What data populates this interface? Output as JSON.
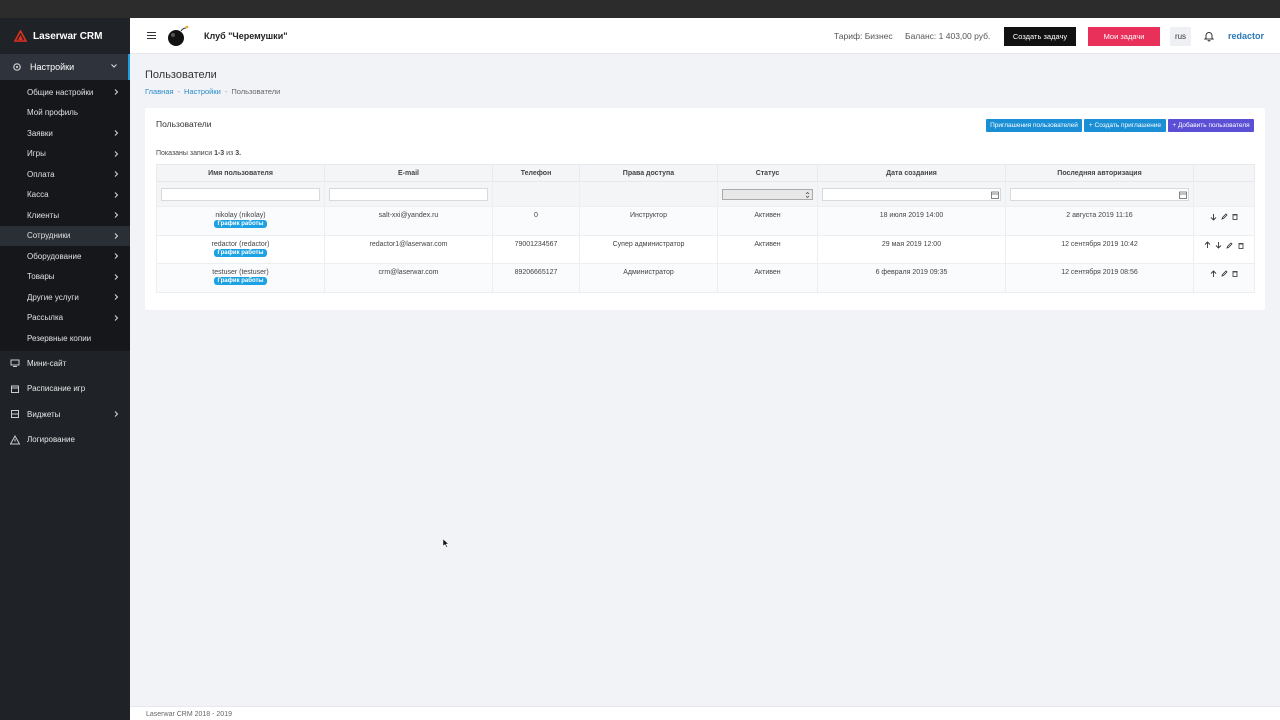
{
  "brand": {
    "name": "Laserwar CRM",
    "accent": "#e0301e"
  },
  "sidebar": {
    "settings_label": "Настройки",
    "sub_items": [
      {
        "label": "Общие настройки",
        "chev": true,
        "active": false
      },
      {
        "label": "Мой профиль",
        "chev": false,
        "active": false
      },
      {
        "label": "Заявки",
        "chev": true,
        "active": false
      },
      {
        "label": "Игры",
        "chev": true,
        "active": false
      },
      {
        "label": "Оплата",
        "chev": true,
        "active": false
      },
      {
        "label": "Касса",
        "chev": true,
        "active": false
      },
      {
        "label": "Клиенты",
        "chev": true,
        "active": false
      },
      {
        "label": "Сотрудники",
        "chev": true,
        "active": true
      },
      {
        "label": "Оборудование",
        "chev": true,
        "active": false
      },
      {
        "label": "Товары",
        "chev": true,
        "active": false
      },
      {
        "label": "Другие услуги",
        "chev": true,
        "active": false
      },
      {
        "label": "Рассылка",
        "chev": true,
        "active": false
      },
      {
        "label": "Резервные копии",
        "chev": false,
        "active": false
      }
    ],
    "main_items": [
      {
        "label": "Мини-сайт",
        "icon": "monitor-icon",
        "chev": false
      },
      {
        "label": "Расписание игр",
        "icon": "calendar-icon",
        "chev": false
      },
      {
        "label": "Виджеты",
        "icon": "widgets-icon",
        "chev": true
      },
      {
        "label": "Логирование",
        "icon": "warning-icon",
        "chev": false
      }
    ]
  },
  "header": {
    "club": "Клуб \"Черемушки\"",
    "tariff": "Тариф: Бизнес",
    "balance": "Баланс: 1 403,00 руб.",
    "create_task": "Создать задачу",
    "my_tasks": "Мои задачи",
    "lang": "rus",
    "user": "redactor"
  },
  "page": {
    "title": "Пользователи",
    "breadcrumb": {
      "home": "Главная",
      "settings": "Настройки",
      "current": "Пользователи"
    }
  },
  "card": {
    "title": "Пользователи",
    "btn_invites": "Приглашения пользователей",
    "btn_create_invite": "+ Создать приглашение",
    "btn_add_user": "+ Добавить пользователя",
    "shown_prefix": "Показаны записи ",
    "shown_range": "1-3",
    "shown_mid": " из ",
    "shown_total": "3."
  },
  "table": {
    "headers": [
      "Имя пользователя",
      "E-mail",
      "Телефон",
      "Права доступа",
      "Статус",
      "Дата создания",
      "Последняя авторизация",
      ""
    ],
    "badge": "График работы",
    "rows": [
      {
        "name": "nikolay (nikolay)",
        "email": "salt-xxi@yandex.ru",
        "phone": "0",
        "role": "Инструктор",
        "status": "Активен",
        "created": "18 июля 2019 14:00",
        "last_login": "2 августа 2019 11:16",
        "up": false,
        "down": true
      },
      {
        "name": "redactor (redactor)",
        "email": "redactor1@laserwar.com",
        "phone": "79001234567",
        "role": "Супер администратор",
        "status": "Активен",
        "created": "29 мая 2019 12:00",
        "last_login": "12 сентября 2019 10:42",
        "up": true,
        "down": true
      },
      {
        "name": "testuser (testuser)",
        "email": "crm@laserwar.com",
        "phone": "89206665127",
        "role": "Администратор",
        "status": "Активен",
        "created": "6 февраля 2019 09:35",
        "last_login": "12 сентября 2019 08:56",
        "up": true,
        "down": false
      }
    ]
  },
  "footer": "Laserwar CRM 2018 - 2019",
  "colors": {
    "primary_btn": "#1a8fd6",
    "add_btn": "#5b4fd6",
    "danger_btn": "#e9305a"
  }
}
